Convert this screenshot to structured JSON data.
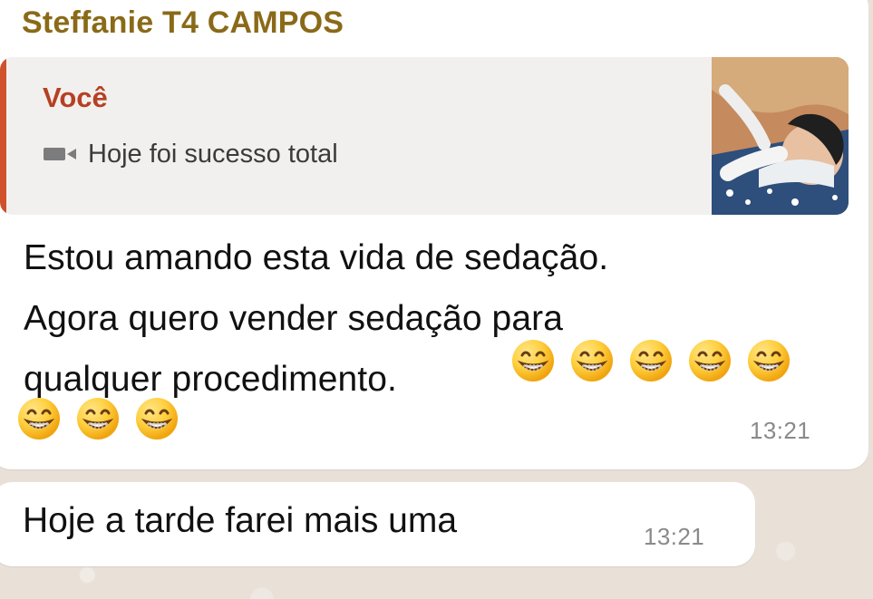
{
  "chat": {
    "message_group": {
      "sender_name": "Steffanie T4 CAMPOS",
      "sender_color": "#8a6a18",
      "quoted_reply": {
        "author": "Você",
        "author_color": "#b64023",
        "accent_bar_color": "#d0512a",
        "media_icon": "video-icon",
        "text": "Hoje foi sucesso total"
      },
      "body_text": "Estou amando esta vida de sedação.\nAgora quero vender sedação para\nqualquer procedimento.",
      "emoji_name": "grinning-face-with-smiling-eyes-icon",
      "emoji_row_1_count": 5,
      "emoji_row_2_count": 3,
      "timestamp": "13:21"
    },
    "second_message": {
      "text": "Hoje a tarde farei mais uma",
      "timestamp": "13:21"
    }
  },
  "colors": {
    "chat_background": "#e9e1d8",
    "bubble_background": "#ffffff",
    "quote_background": "#f2f0ee",
    "timestamp_color": "#8a8a8a"
  }
}
